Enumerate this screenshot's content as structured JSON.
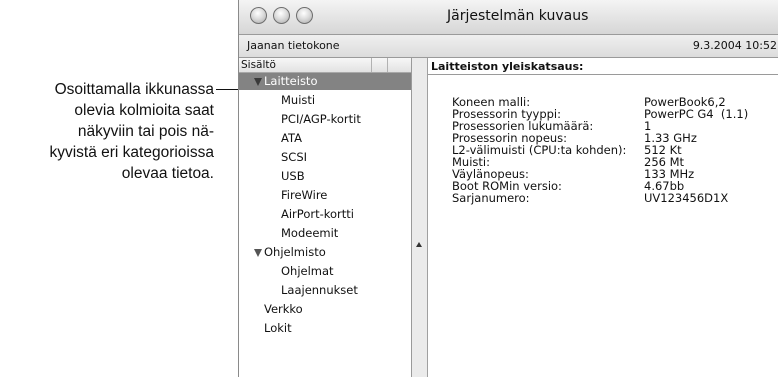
{
  "callout": {
    "lines": [
      "Osoittamalla ikkunassa",
      "olevia kolmioita saat",
      "näkyviin tai pois nä-",
      "kyvistä eri kategorioissa",
      "olevaa tietoa."
    ]
  },
  "window": {
    "title": "Järjestelmän kuvaus",
    "computer_name": "Jaanan tietokone",
    "datetime": "9.3.2004 10:52"
  },
  "sidebar": {
    "header": "Sisältö",
    "items": [
      {
        "label": "Laitteisto",
        "selected": true
      },
      {
        "label": "Muisti"
      },
      {
        "label": "PCI/AGP-kortit"
      },
      {
        "label": "ATA"
      },
      {
        "label": "SCSI"
      },
      {
        "label": "USB"
      },
      {
        "label": "FireWire"
      },
      {
        "label": "AirPort-kortti"
      },
      {
        "label": "Modeemit"
      },
      {
        "label": "Ohjelmisto"
      },
      {
        "label": "Ohjelmat"
      },
      {
        "label": "Laajennukset"
      },
      {
        "label": "Verkko"
      },
      {
        "label": "Lokit"
      }
    ]
  },
  "details": {
    "heading": "Laitteiston yleiskatsaus:",
    "rows": [
      {
        "label": "Koneen malli:",
        "value": "PowerBook6,2"
      },
      {
        "label": "Prosessorin tyyppi:",
        "value": "PowerPC G4  (1.1)"
      },
      {
        "label": "Prosessorien lukumäärä:",
        "value": "1"
      },
      {
        "label": "Prosessorin nopeus:",
        "value": "1.33 GHz"
      },
      {
        "label": "L2-välimuisti (CPU:ta kohden):",
        "value": "512 Kt"
      },
      {
        "label": "Muisti:",
        "value": "256 Mt"
      },
      {
        "label": "Väylänopeus:",
        "value": "133 MHz"
      },
      {
        "label": "Boot ROMin versio:",
        "value": "4.67bb"
      },
      {
        "label": "Sarjanumero:",
        "value": "UV123456D1X"
      }
    ]
  }
}
